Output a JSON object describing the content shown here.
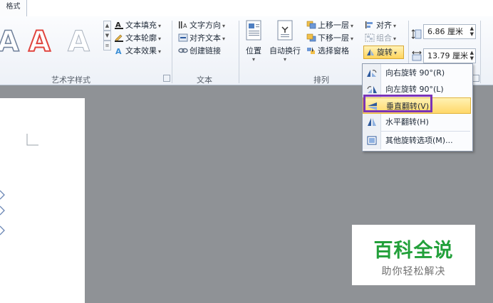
{
  "tab": {
    "label": "格式"
  },
  "groups": {
    "art": "艺术字样式",
    "text": "文本",
    "arrange": "排列"
  },
  "art": {
    "fill": "文本填充",
    "outline": "文本轮廓",
    "effect": "文本效果",
    "sample_glyph": "A"
  },
  "text": {
    "direction": "文字方向",
    "align": "对齐文本",
    "link": "创建链接"
  },
  "arrange": {
    "position": "位置",
    "wrap": "自动换行",
    "bring_forward": "上移一层",
    "send_backward": "下移一层",
    "selection_pane": "选择窗格",
    "align": "对齐",
    "group": "组合",
    "rotate": "旋转"
  },
  "size": {
    "height": "6.86 厘米",
    "width": "13.79 厘米"
  },
  "rotate_menu": {
    "items": [
      {
        "label": "向右旋转 90°(R)",
        "icon": "rotate-right-icon"
      },
      {
        "label": "向左旋转 90°(L)",
        "icon": "rotate-left-icon"
      },
      {
        "label": "垂直翻转(V)",
        "icon": "flip-vertical-icon",
        "highlighted": true
      },
      {
        "label": "水平翻转(H)",
        "icon": "flip-horizontal-icon"
      },
      {
        "label": "其他旋转选项(M)...",
        "icon": "more-rotation-icon"
      }
    ]
  },
  "watermark": {
    "title": "百科全说",
    "subtitle": "助你轻松解决"
  },
  "colors": {
    "accent_red": "#e0453f",
    "highlight": "#7a33b8",
    "brand_green": "#22a03a"
  }
}
